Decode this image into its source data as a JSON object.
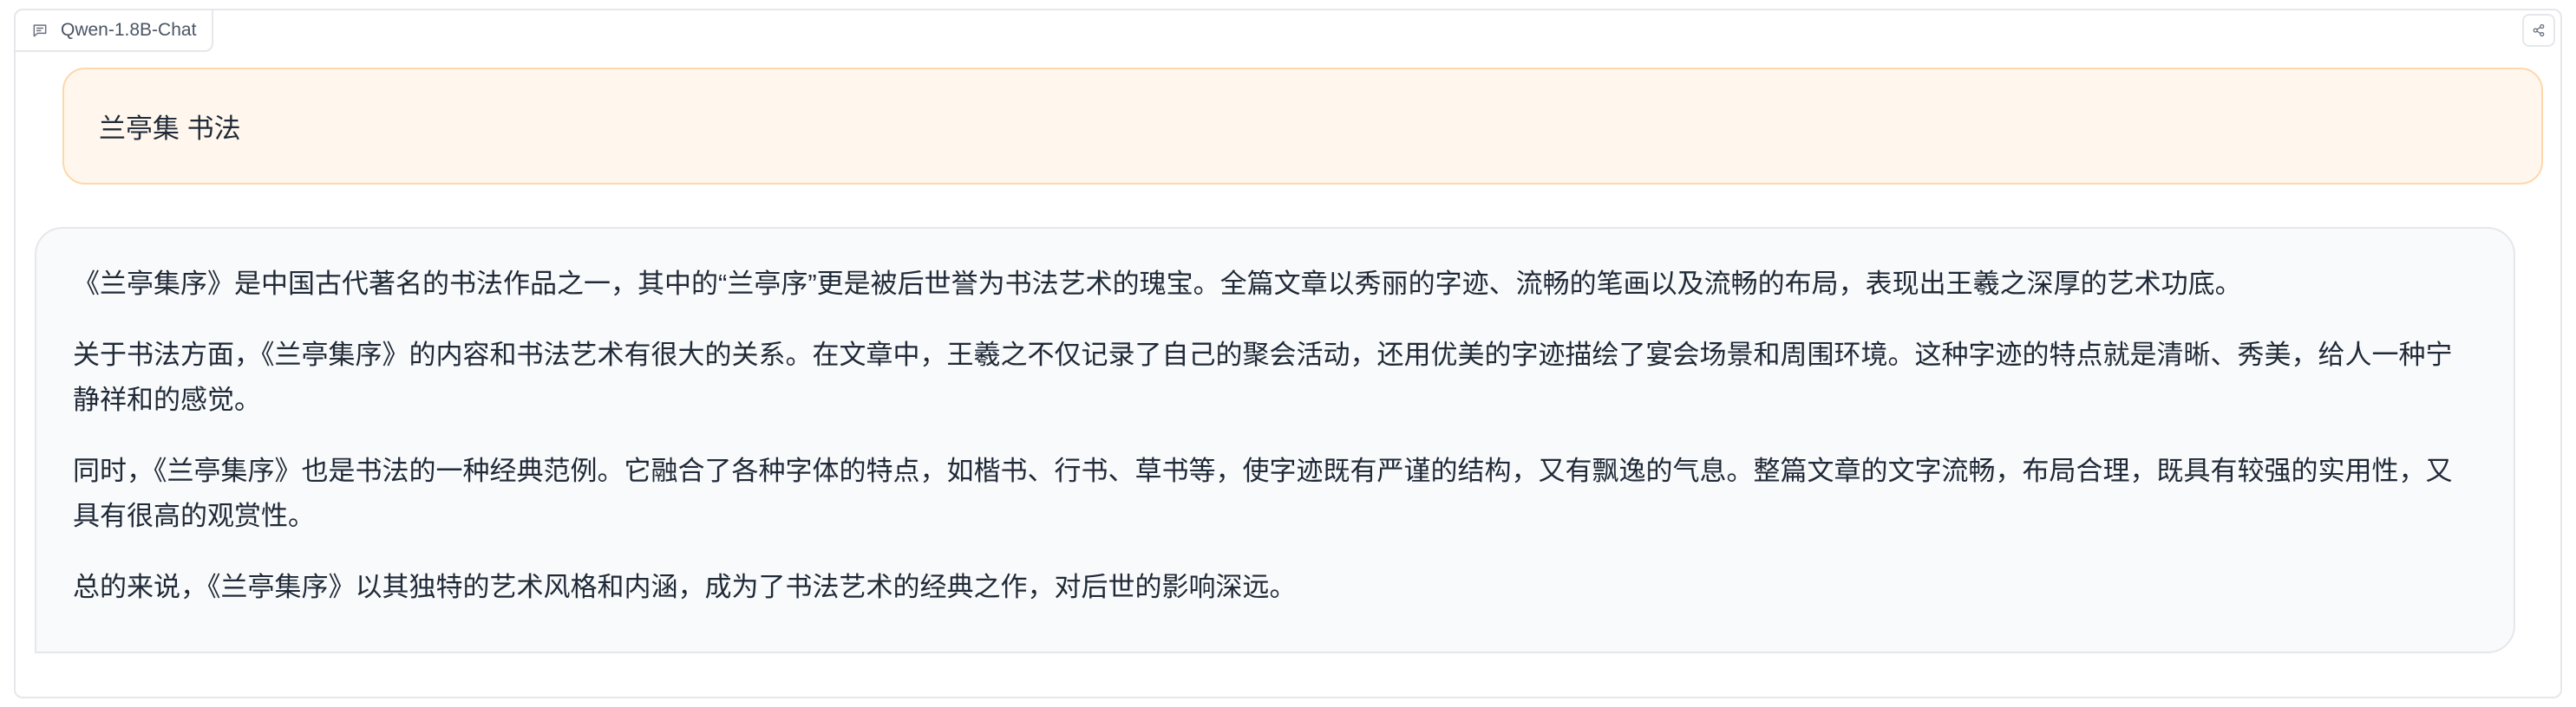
{
  "chatbot": {
    "label": "Qwen-1.8B-Chat",
    "label_icon": "chat-icon",
    "share_icon": "share-icon"
  },
  "messages": {
    "user": "兰亭集 书法",
    "bot": [
      "《兰亭集序》是中国古代著名的书法作品之一，其中的“兰亭序”更是被后世誉为书法艺术的瑰宝。全篇文章以秀丽的字迹、流畅的笔画以及流畅的布局，表现出王羲之深厚的艺术功底。",
      "关于书法方面，《兰亭集序》的内容和书法艺术有很大的关系。在文章中，王羲之不仅记录了自己的聚会活动，还用优美的字迹描绘了宴会场景和周围环境。这种字迹的特点就是清晰、秀美，给人一种宁静祥和的感觉。",
      "同时，《兰亭集序》也是书法的一种经典范例。它融合了各种字体的特点，如楷书、行书、草书等，使字迹既有严谨的结构，又有飘逸的气息。整篇文章的文字流畅，布局合理，既具有较强的实用性，又具有很高的观赏性。",
      "总的来说，《兰亭集序》以其独特的艺术风格和内涵，成为了书法艺术的经典之作，对后世的影响深远。"
    ]
  },
  "colors": {
    "user_bubble_bg": "#fff7ed",
    "user_bubble_border": "#fed7aa",
    "bot_bubble_bg": "#f9fafb",
    "border": "#e5e7eb",
    "text": "#1f2937"
  }
}
